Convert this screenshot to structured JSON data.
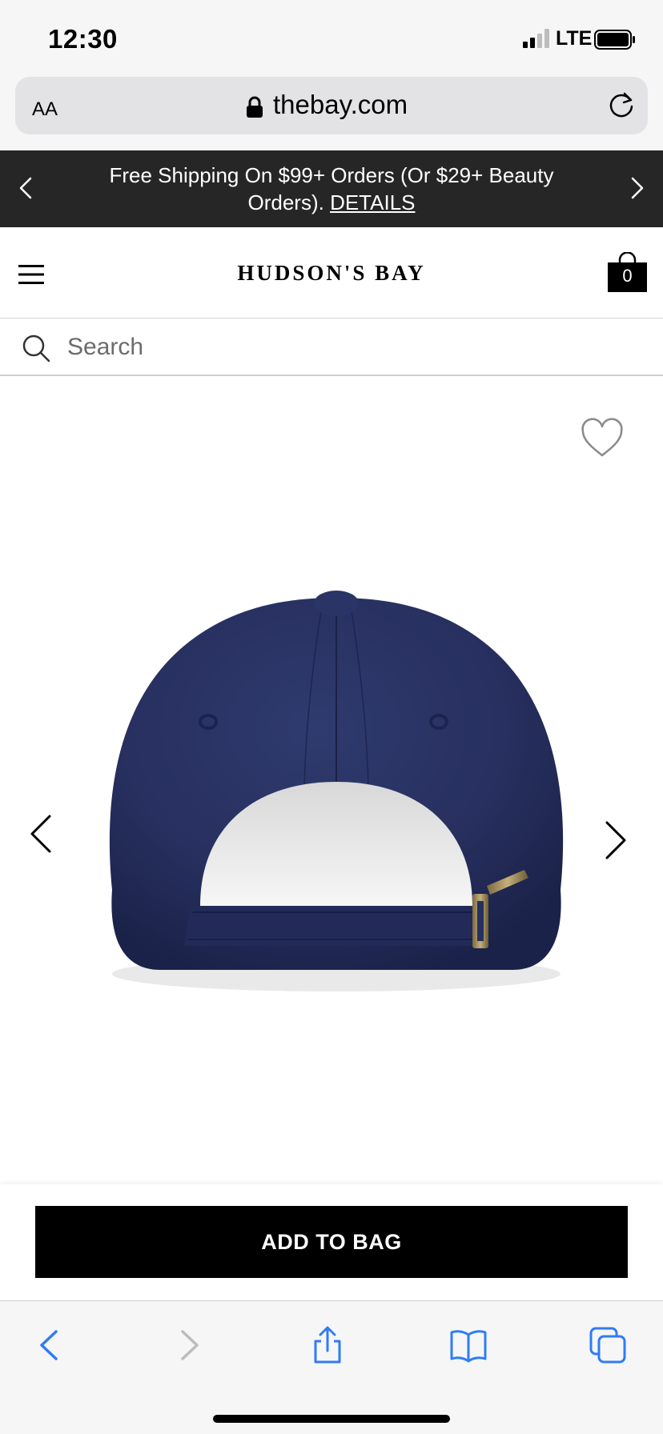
{
  "status_bar": {
    "time": "12:30",
    "network": "LTE"
  },
  "browser": {
    "text_size_label": "AA",
    "url": "thebay.com"
  },
  "promo": {
    "text": "Free Shipping On $99+ Orders (Or $29+ Beauty Orders).",
    "link": "DETAILS"
  },
  "header": {
    "logo": "HUDSON'S BAY",
    "bag_count": "0"
  },
  "search": {
    "placeholder": "Search"
  },
  "product": {
    "image_alt": "navy blue baseball cap, back view"
  },
  "actions": {
    "add_to_bag": "ADD TO BAG"
  },
  "colors": {
    "promo_bg": "#262626",
    "button_bg": "#000000",
    "toolbar_accent": "#2f7cf6"
  }
}
